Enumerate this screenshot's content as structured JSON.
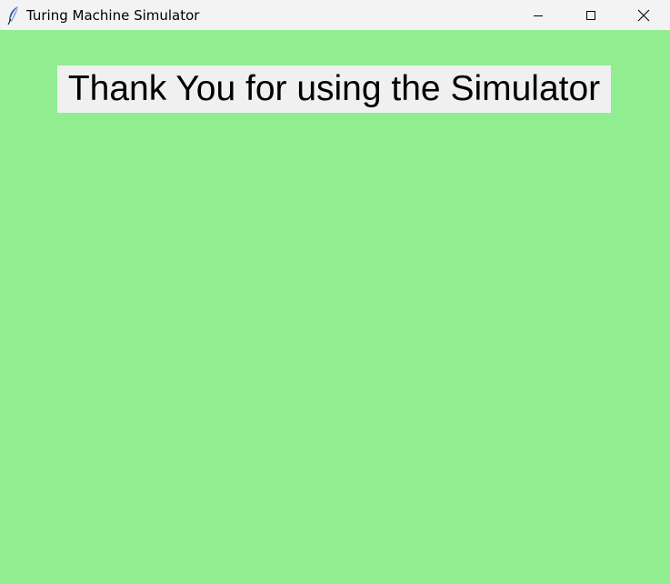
{
  "window": {
    "title": "Turing Machine Simulator",
    "icon": "feather-icon",
    "background_color": "#90ee90"
  },
  "title_controls": [
    "minimize-icon",
    "maximize-icon",
    "close-icon"
  ],
  "main": {
    "message": "Thank You for using the Simulator",
    "label_background": "#f0f0f0"
  }
}
